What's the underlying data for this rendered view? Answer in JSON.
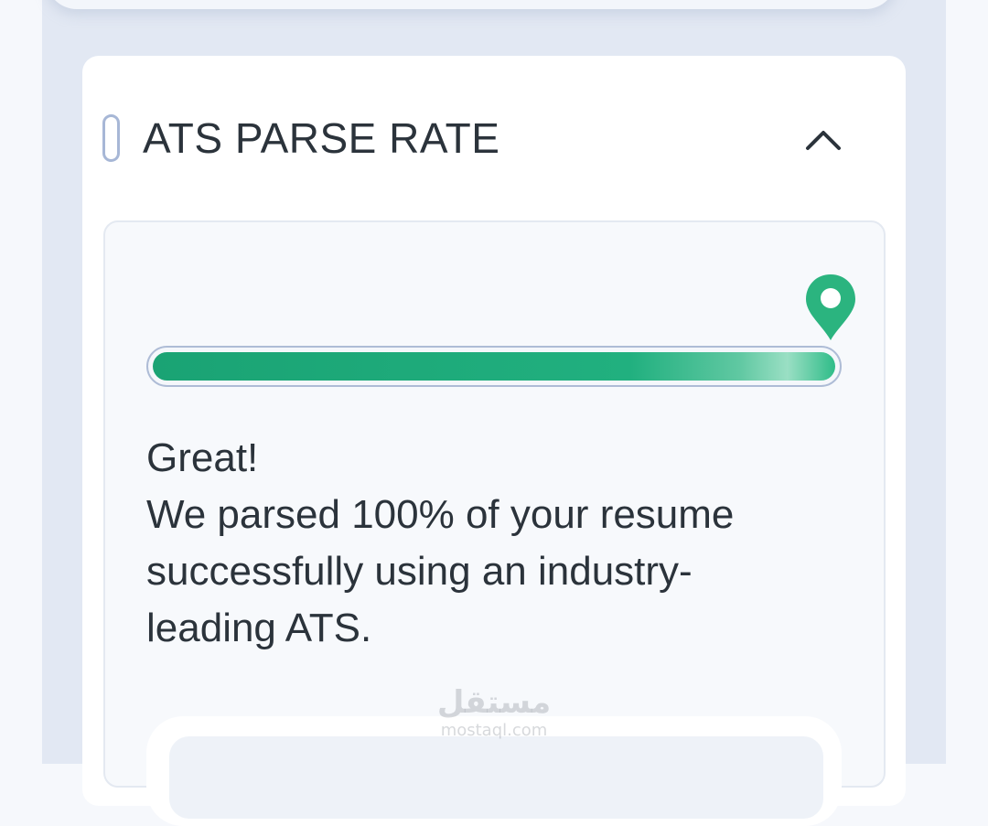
{
  "section": {
    "title": "ATS PARSE RATE",
    "expanded": true
  },
  "parse_rate": {
    "percent": 100,
    "fill_colors": [
      "#1aa374",
      "#2fbc88"
    ],
    "marker_color": "#2bb47f"
  },
  "message": {
    "headline": "Great!",
    "line1": "We parsed 100% of your resume",
    "line2": "successfully using an industry-",
    "line3": "leading ATS."
  },
  "watermark": {
    "logo": "مستقل",
    "site": "mostaql.com"
  },
  "icons": {
    "collapse": "chevron-up-icon",
    "marker": "map-pin-icon",
    "section": "section-marker"
  }
}
